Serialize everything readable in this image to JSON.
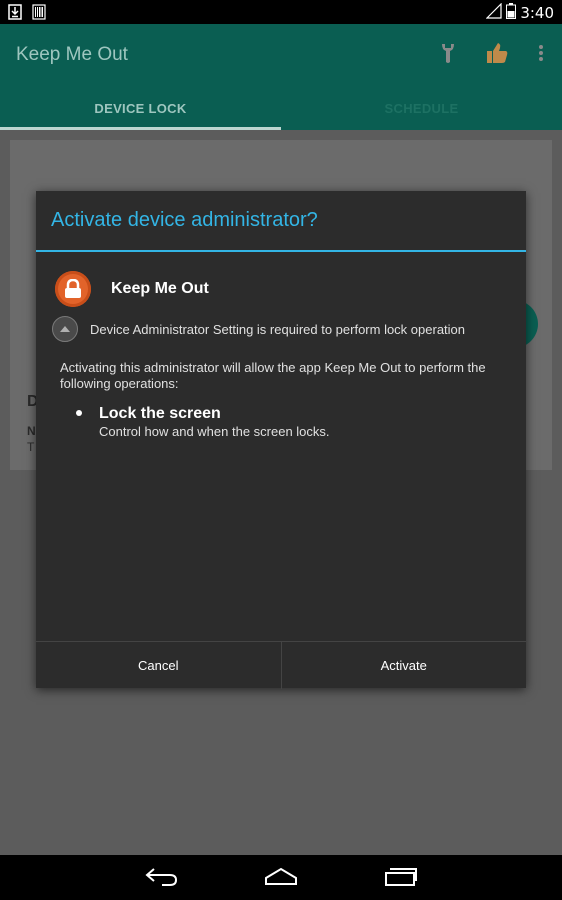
{
  "status_bar": {
    "time": "3:40"
  },
  "app_bar": {
    "title": "Keep Me Out",
    "tabs": [
      {
        "label": "DEVICE LOCK"
      },
      {
        "label": "SCHEDULE"
      }
    ]
  },
  "dialog": {
    "title": "Activate device administrator?",
    "app_name": "Keep Me Out",
    "expand_text": "Device Administrator Setting is required to perform lock operation",
    "description": "Activating this administrator will allow the app Keep Me Out to perform the following operations:",
    "policy": {
      "title": "Lock the screen",
      "description": "Control how and when the screen locks."
    },
    "buttons": {
      "cancel": "Cancel",
      "activate": "Activate"
    }
  },
  "background_fragments": {
    "letter_d": "D",
    "letter_n": "N",
    "letter_t": "T"
  },
  "colors": {
    "accent": "#33b5e5",
    "app_bar": "#0a5e52",
    "app_icon": "#e2632a"
  },
  "icons": [
    "download-icon",
    "barcode-icon",
    "signal-icon",
    "battery-icon",
    "wrench-icon",
    "thumbs-up-icon",
    "more-vert-icon",
    "lock-icon",
    "expand-icon",
    "back-icon",
    "home-icon",
    "recents-icon"
  ]
}
